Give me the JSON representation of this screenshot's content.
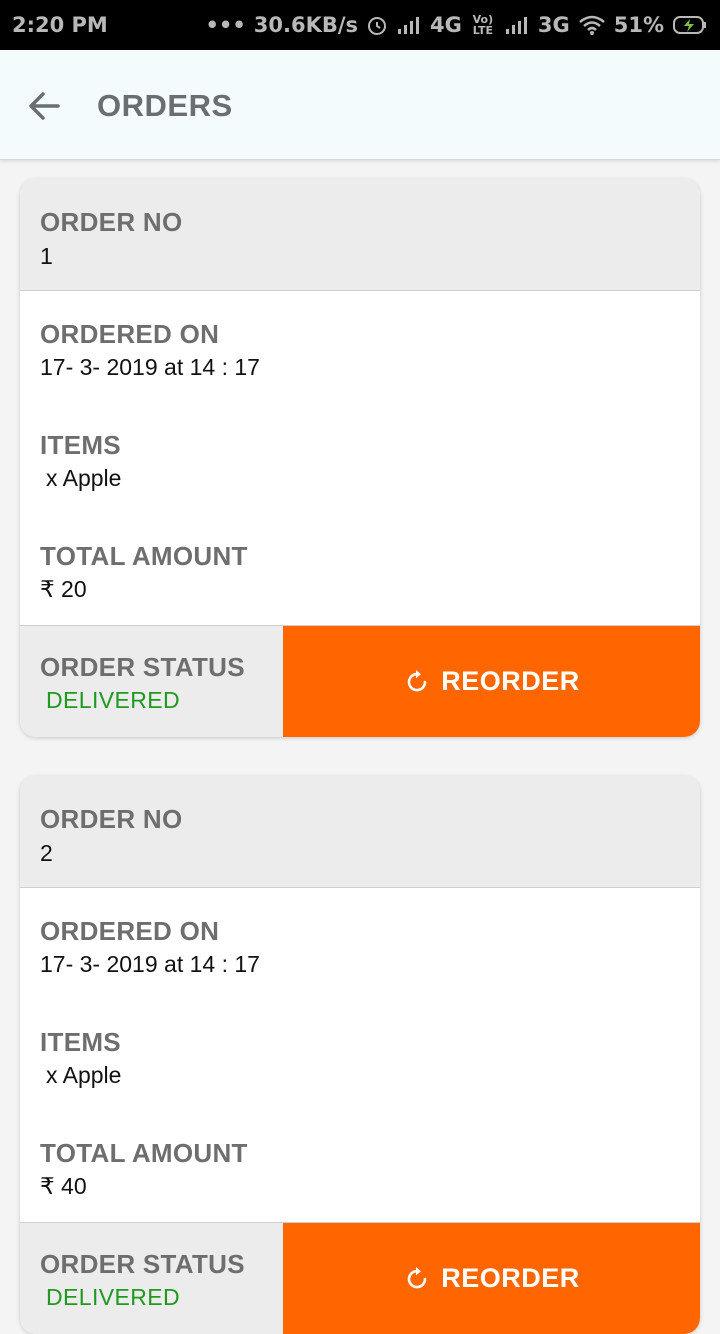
{
  "status_bar": {
    "time": "2:20 PM",
    "network_speed": "30.6KB/s",
    "network_4g": "4G",
    "volte_label": "Vo) LTE",
    "network_3g": "3G",
    "battery": "51%",
    "icons": [
      "dots-icon",
      "alarm-icon",
      "signal-icon",
      "signal-icon",
      "wifi-icon",
      "battery-charging-icon"
    ]
  },
  "header": {
    "title": "ORDERS",
    "back_icon": "arrow-left-icon",
    "background_color": "#f4fbfd"
  },
  "labels": {
    "order_no": "ORDER NO",
    "ordered_on": "ORDERED ON",
    "items": "ITEMS",
    "total_amount": "TOTAL AMOUNT",
    "order_status": "ORDER STATUS",
    "reorder": "REORDER"
  },
  "orders": [
    {
      "order_no": "1",
      "ordered_on": "17- 3- 2019 at 14 : 17",
      "items": "x Apple",
      "total_amount": "₹ 20",
      "status": "DELIVERED"
    },
    {
      "order_no": "2",
      "ordered_on": "17- 3- 2019 at 14 : 17",
      "items": "x Apple",
      "total_amount": "₹ 40",
      "status": "DELIVERED"
    }
  ],
  "colors": {
    "accent": "#ff6600",
    "status_delivered": "#1f9a1f",
    "label_gray": "#6e6e6e"
  }
}
